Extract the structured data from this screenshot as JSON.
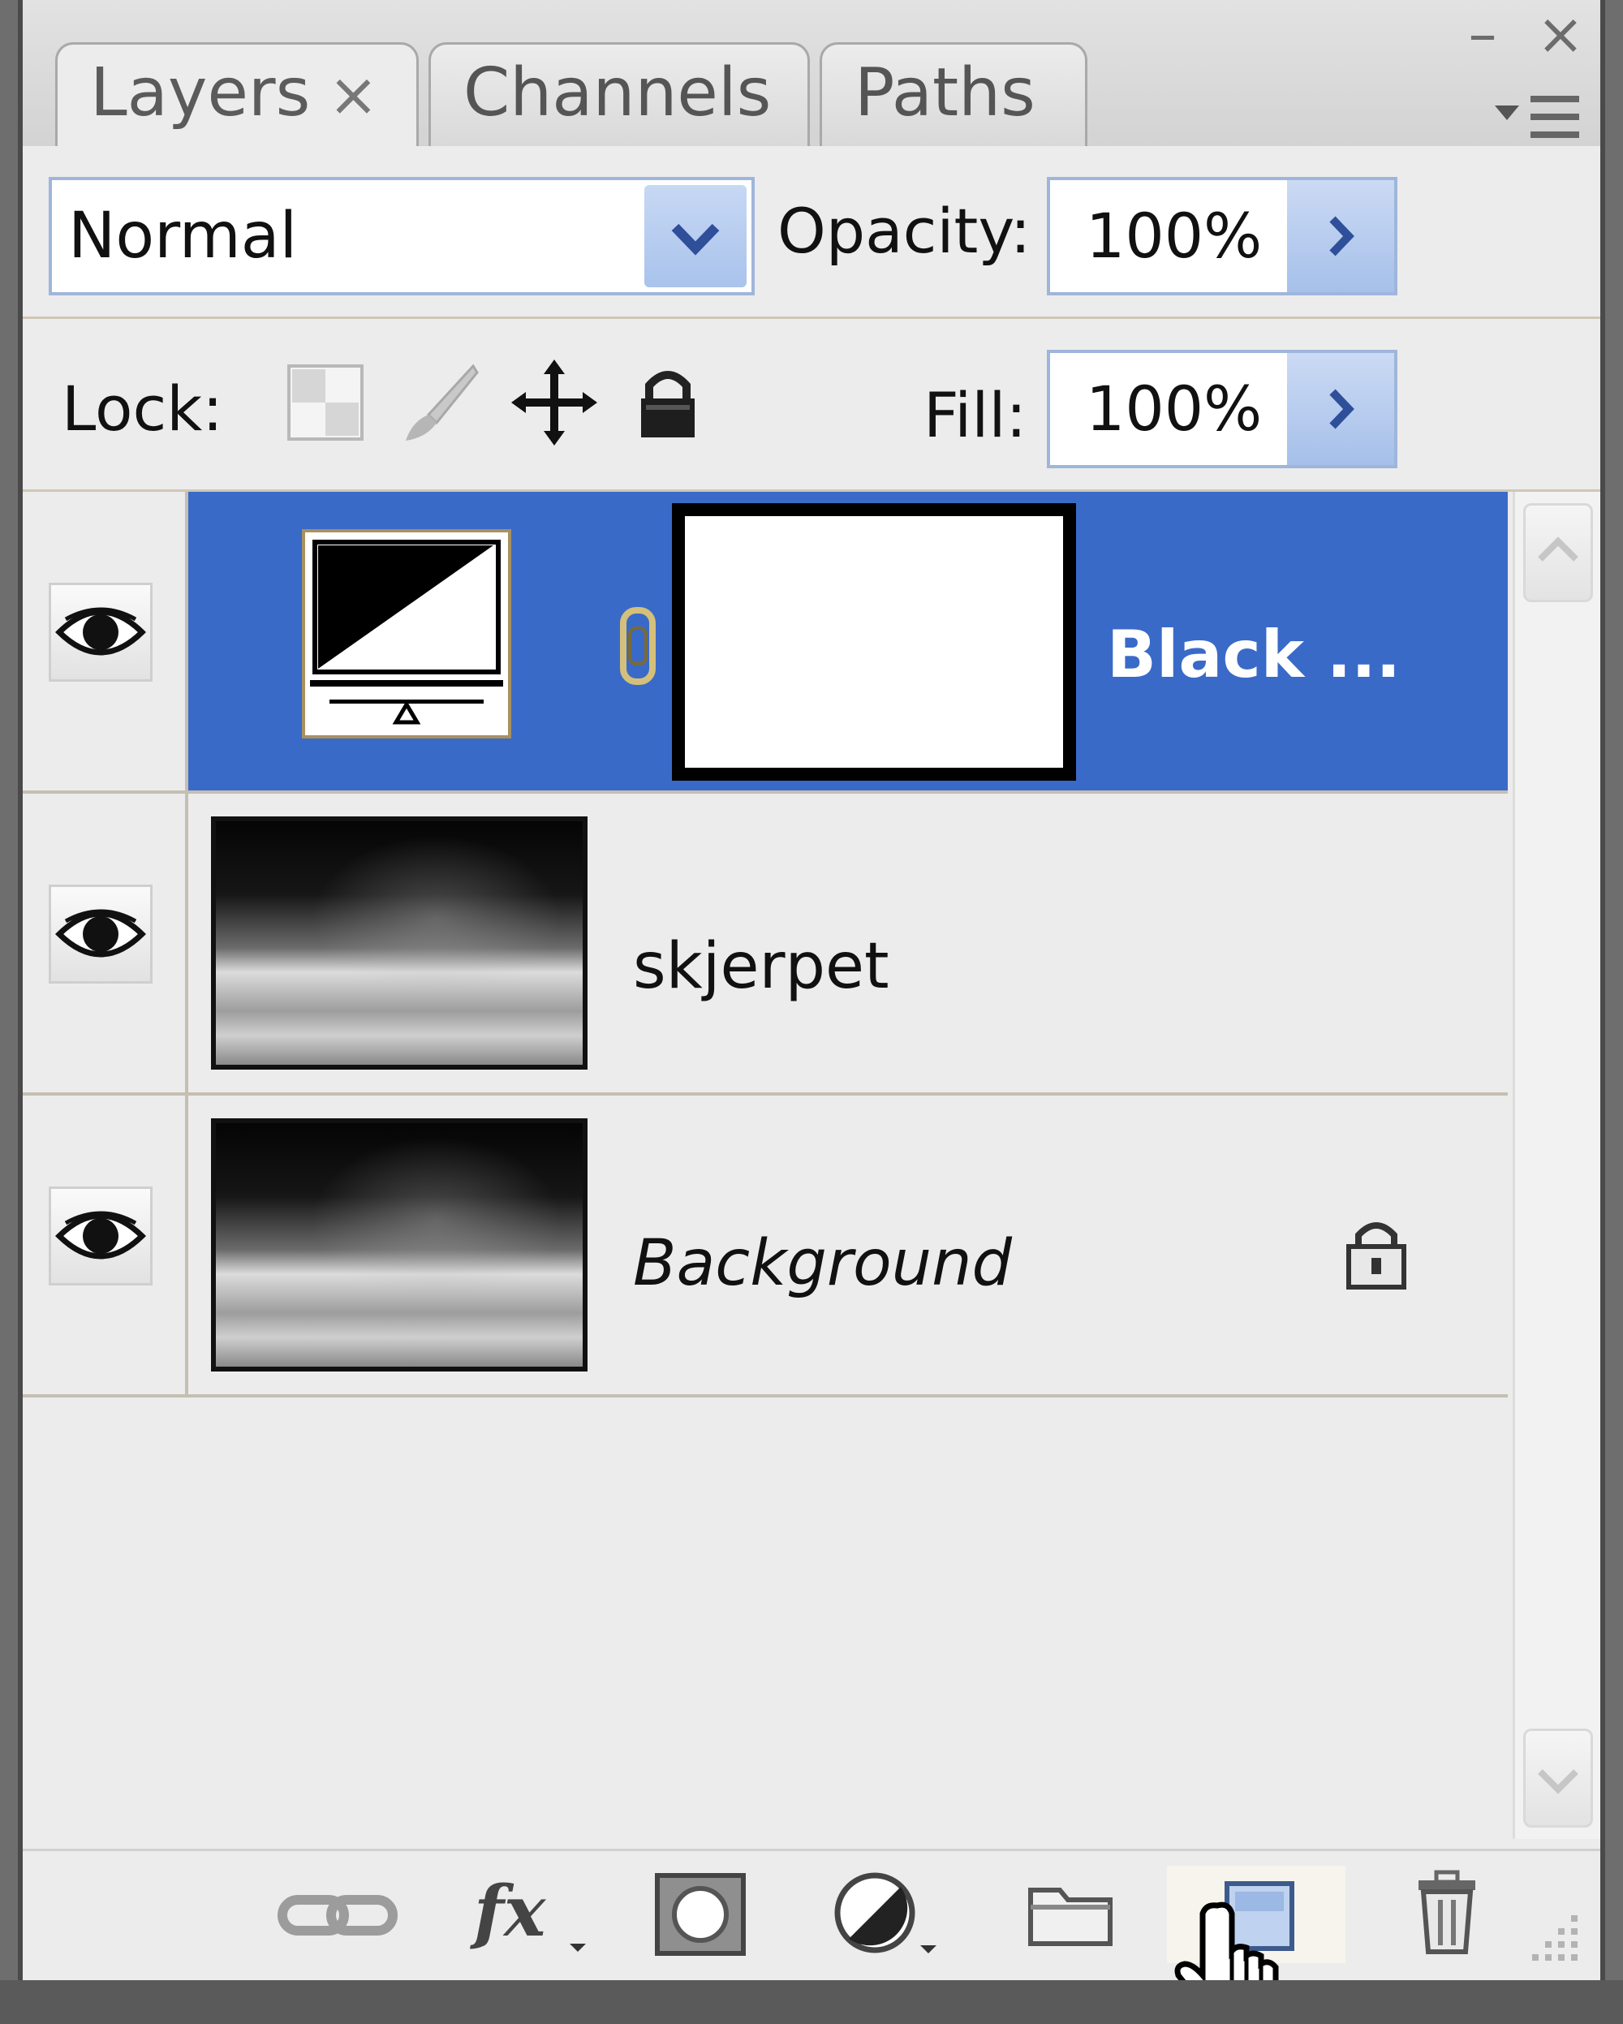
{
  "tabs": [
    {
      "label": "Layers",
      "close": "×"
    },
    {
      "label": "Channels"
    },
    {
      "label": "Paths"
    }
  ],
  "window": {
    "minimize": "–",
    "close": "×"
  },
  "blend_mode": {
    "value": "Normal"
  },
  "opacity": {
    "label": "Opacity:",
    "value": "100%"
  },
  "lock": {
    "label": "Lock:"
  },
  "fill": {
    "label": "Fill:",
    "value": "100%"
  },
  "layers": [
    {
      "name": "Black ...",
      "selected": true,
      "visible": true,
      "type": "adjustment"
    },
    {
      "name": "skjerpet",
      "visible": true
    },
    {
      "name": "Background",
      "visible": true,
      "locked": true
    }
  ],
  "colors": {
    "selection": "#3a6ac8",
    "panel": "#ececec",
    "field_border": "#9fb6db"
  },
  "footer_icons": [
    "link-icon",
    "fx-icon",
    "mask-icon",
    "adjustment-icon",
    "folder-icon",
    "new-layer-icon",
    "trash-icon"
  ]
}
